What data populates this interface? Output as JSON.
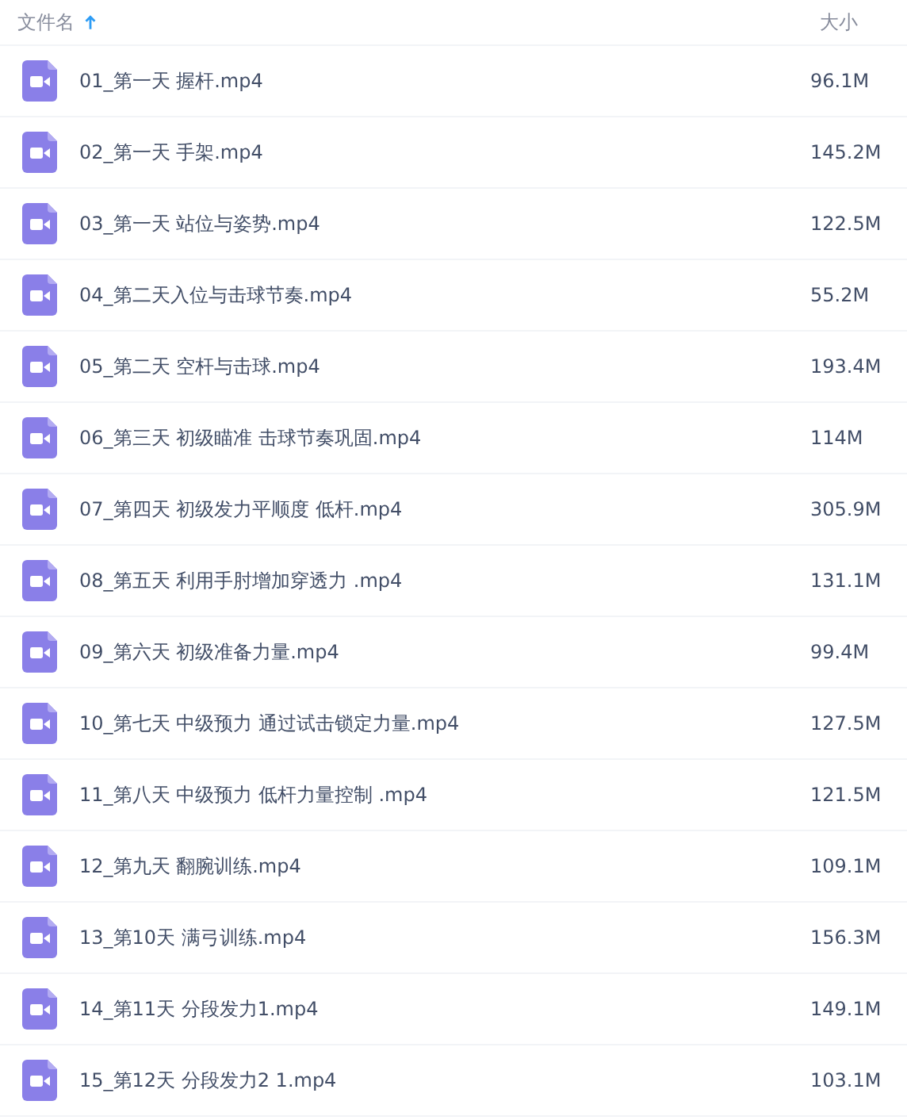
{
  "header": {
    "name_column": "文件名",
    "size_column": "大小",
    "sort_ascending": true
  },
  "files": [
    {
      "name": "01_第一天 握杆.mp4",
      "size": "96.1M"
    },
    {
      "name": "02_第一天 手架.mp4",
      "size": "145.2M"
    },
    {
      "name": "03_第一天 站位与姿势.mp4",
      "size": "122.5M"
    },
    {
      "name": "04_第二天入位与击球节奏.mp4",
      "size": "55.2M"
    },
    {
      "name": "05_第二天 空杆与击球.mp4",
      "size": "193.4M"
    },
    {
      "name": "06_第三天 初级瞄准 击球节奏巩固.mp4",
      "size": "114M"
    },
    {
      "name": "07_第四天 初级发力平顺度 低杆.mp4",
      "size": "305.9M"
    },
    {
      "name": "08_第五天 利用手肘增加穿透力 .mp4",
      "size": "131.1M"
    },
    {
      "name": "09_第六天 初级准备力量.mp4",
      "size": "99.4M"
    },
    {
      "name": "10_第七天 中级预力 通过试击锁定力量.mp4",
      "size": "127.5M"
    },
    {
      "name": "11_第八天 中级预力 低杆力量控制 .mp4",
      "size": "121.5M"
    },
    {
      "name": "12_第九天 翻腕训练.mp4",
      "size": "109.1M"
    },
    {
      "name": "13_第10天 满弓训练.mp4",
      "size": "156.3M"
    },
    {
      "name": "14_第11天 分段发力1.mp4",
      "size": "149.1M"
    },
    {
      "name": "15_第12天 分段发力2 1.mp4",
      "size": "103.1M"
    }
  ]
}
